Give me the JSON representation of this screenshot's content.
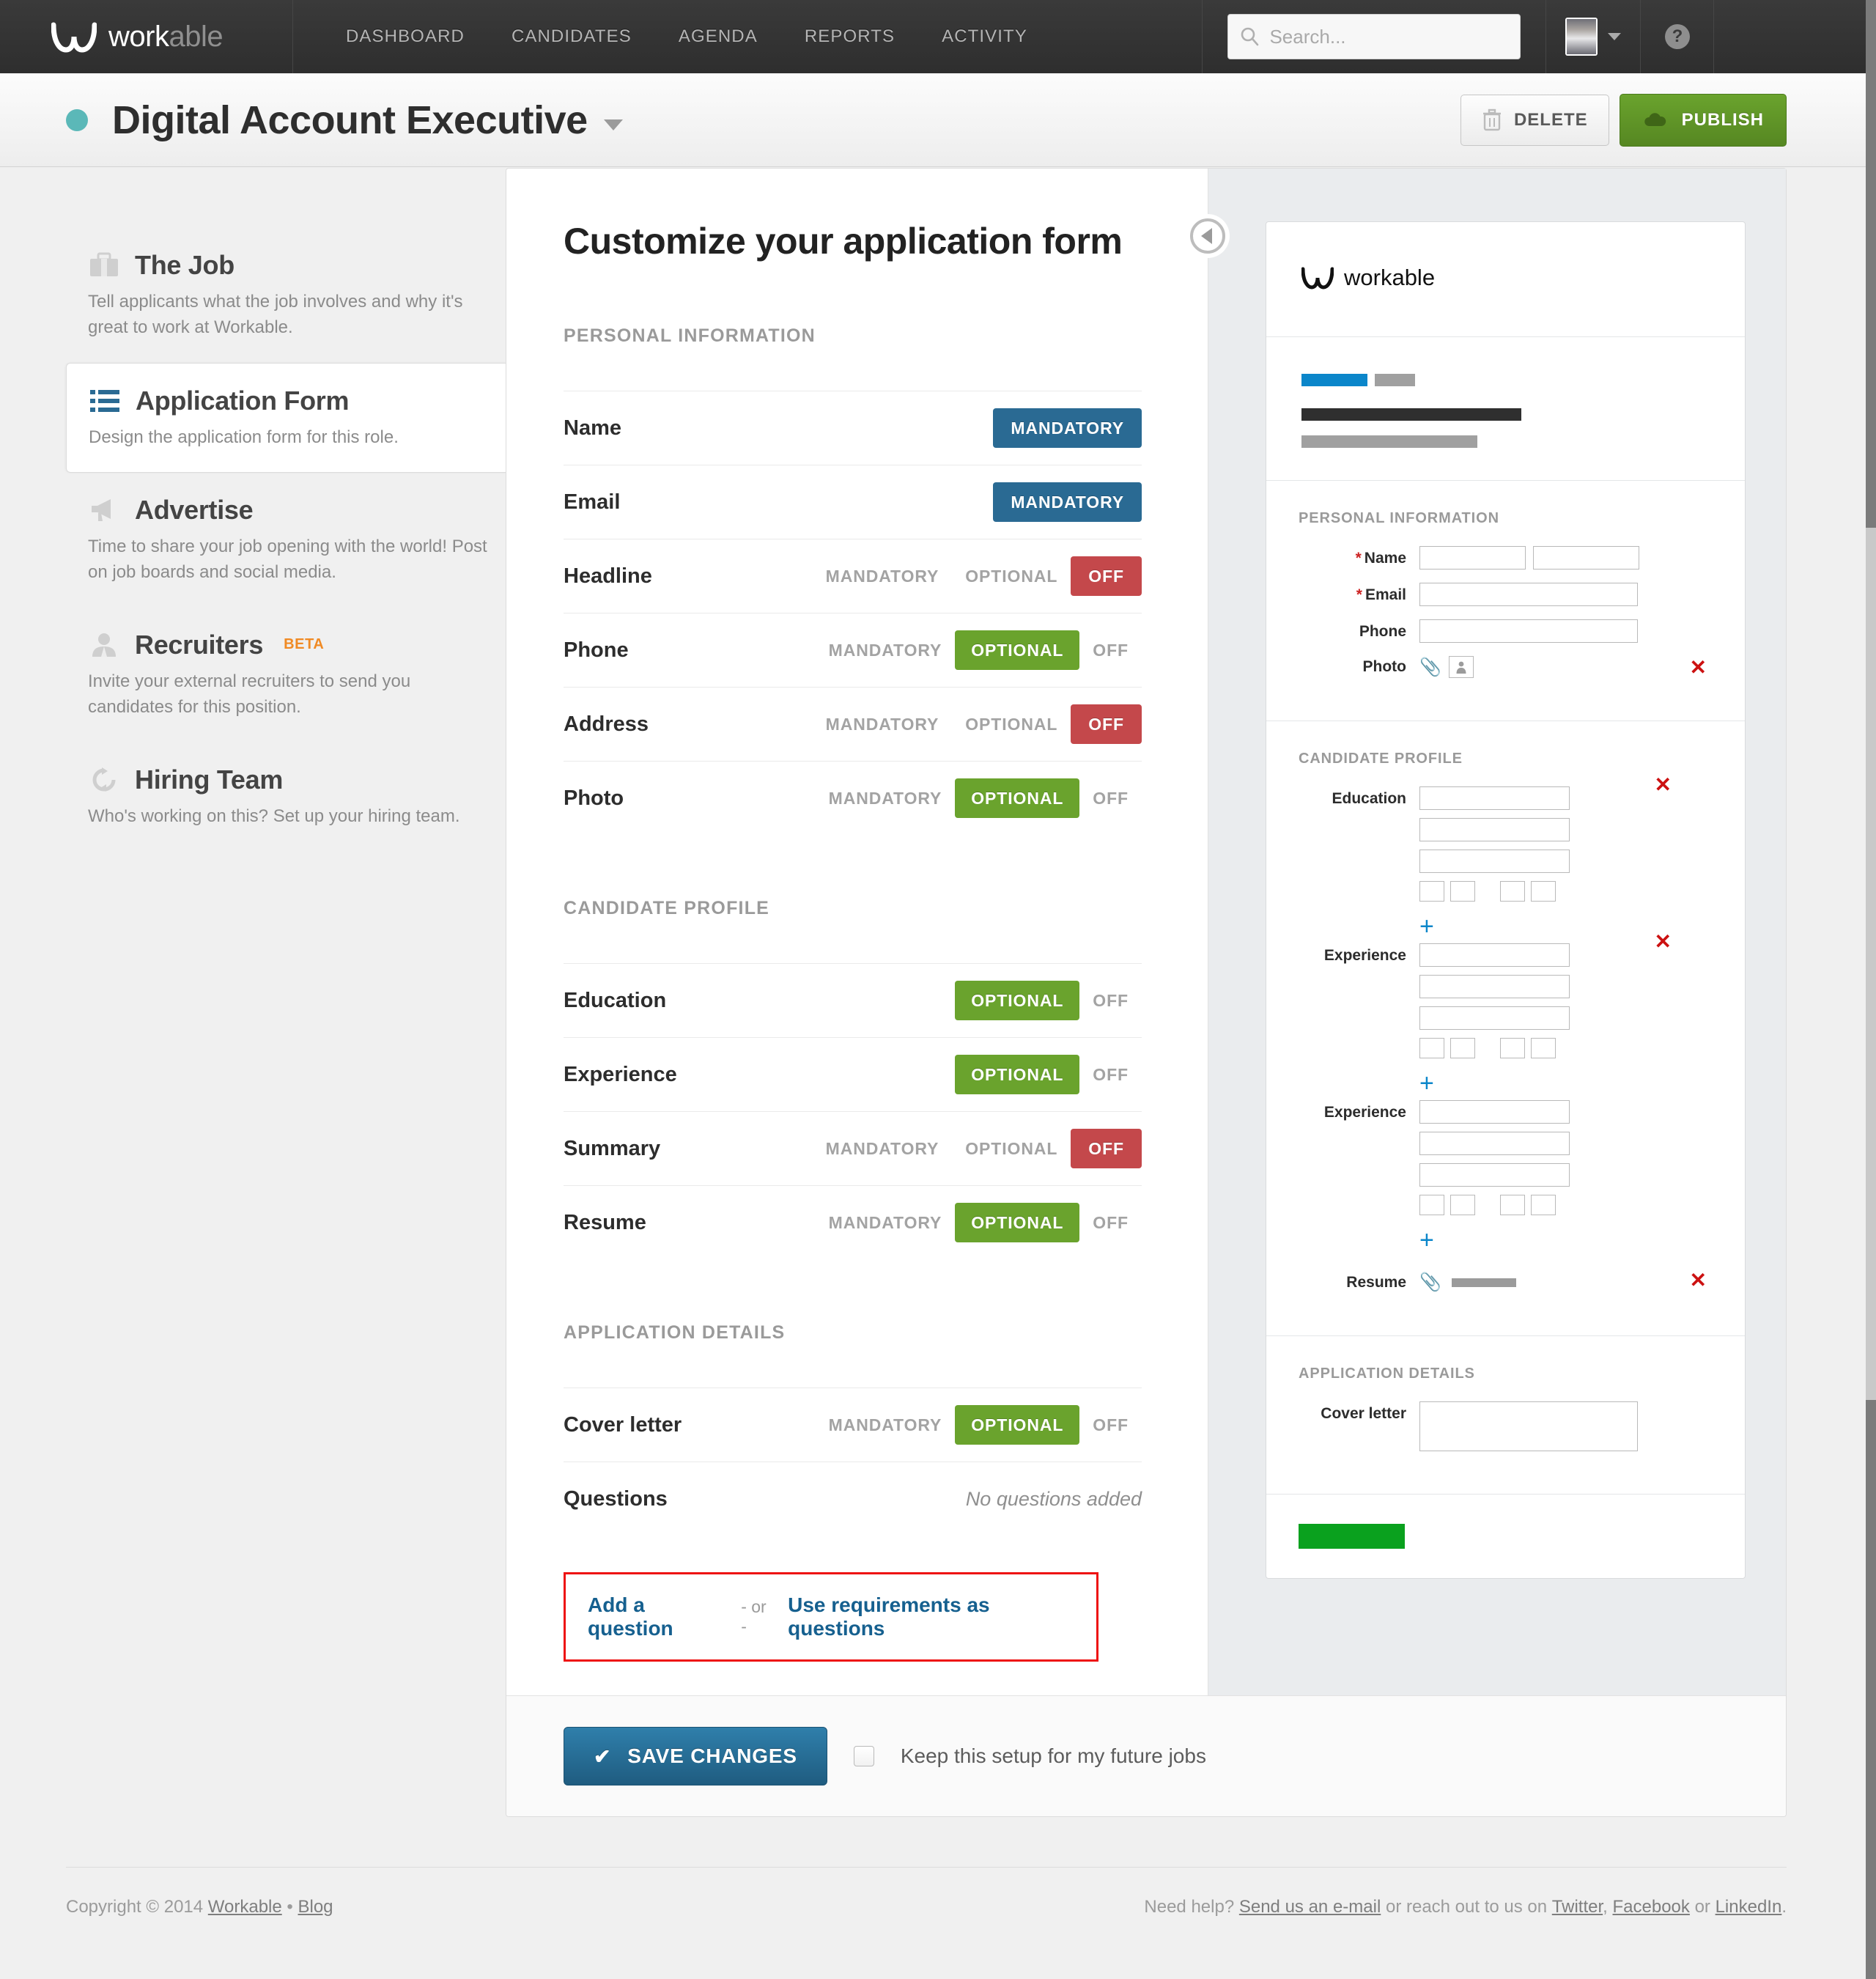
{
  "nav": {
    "brand": {
      "prefix": "work",
      "suffix": "able"
    },
    "links": [
      "DASHBOARD",
      "CANDIDATES",
      "AGENDA",
      "REPORTS",
      "ACTIVITY"
    ],
    "search_placeholder": "Search...",
    "help_glyph": "?"
  },
  "jobbar": {
    "title": "Digital Account Executive",
    "delete_label": "DELETE",
    "publish_label": "PUBLISH"
  },
  "sidebar": {
    "items": [
      {
        "title": "The Job",
        "desc": "Tell applicants what the job involves and why it's great to work at Workable.",
        "icon": "briefcase-icon",
        "active": false
      },
      {
        "title": "Application Form",
        "desc": "Design the application form for this role.",
        "icon": "list-icon",
        "active": true
      },
      {
        "title": "Advertise",
        "desc": "Time to share your job opening with the world! Post on job boards and social media.",
        "icon": "megaphone-icon",
        "active": false
      },
      {
        "title": "Recruiters",
        "badge": "BETA",
        "desc": "Invite your external recruiters to send you candidates for this position.",
        "icon": "person-icon",
        "active": false
      },
      {
        "title": "Hiring Team",
        "desc": "Who's working on this? Set up your hiring team.",
        "icon": "refresh-icon",
        "active": false
      }
    ]
  },
  "form": {
    "title": "Customize your application form",
    "options": {
      "mandatory": "MANDATORY",
      "optional": "OPTIONAL",
      "off": "OFF"
    },
    "sections": [
      {
        "label": "PERSONAL INFORMATION",
        "rows": [
          {
            "label": "Name",
            "choices": [
              "mandatory"
            ],
            "selected": "mandatory"
          },
          {
            "label": "Email",
            "choices": [
              "mandatory"
            ],
            "selected": "mandatory"
          },
          {
            "label": "Headline",
            "choices": [
              "mandatory",
              "optional",
              "off"
            ],
            "selected": "off"
          },
          {
            "label": "Phone",
            "choices": [
              "mandatory",
              "optional",
              "off"
            ],
            "selected": "optional"
          },
          {
            "label": "Address",
            "choices": [
              "mandatory",
              "optional",
              "off"
            ],
            "selected": "off"
          },
          {
            "label": "Photo",
            "choices": [
              "mandatory",
              "optional",
              "off"
            ],
            "selected": "optional"
          }
        ]
      },
      {
        "label": "CANDIDATE PROFILE",
        "rows": [
          {
            "label": "Education",
            "choices": [
              "optional",
              "off"
            ],
            "selected": "optional"
          },
          {
            "label": "Experience",
            "choices": [
              "optional",
              "off"
            ],
            "selected": "optional"
          },
          {
            "label": "Summary",
            "choices": [
              "mandatory",
              "optional",
              "off"
            ],
            "selected": "off"
          },
          {
            "label": "Resume",
            "choices": [
              "mandatory",
              "optional",
              "off"
            ],
            "selected": "optional"
          }
        ]
      },
      {
        "label": "APPLICATION DETAILS",
        "rows": [
          {
            "label": "Cover letter",
            "choices": [
              "mandatory",
              "optional",
              "off"
            ],
            "selected": "optional"
          },
          {
            "label": "Questions",
            "choices": [],
            "note": "No questions added"
          }
        ]
      }
    ],
    "add_question_label": "Add a question",
    "or_label": "- or -",
    "use_requirements_label": "Use requirements as questions"
  },
  "preview": {
    "brand": {
      "prefix": "work",
      "suffix": "able"
    },
    "sections": [
      {
        "label": "PERSONAL INFORMATION",
        "fields": [
          "Name",
          "Email",
          "Phone",
          "Photo"
        ]
      },
      {
        "label": "CANDIDATE PROFILE",
        "fields": [
          "Education",
          "Experience",
          "Experience",
          "Resume"
        ]
      },
      {
        "label": "APPLICATION DETAILS",
        "fields": [
          "Cover letter"
        ]
      }
    ],
    "labels": {
      "name": "Name",
      "email": "Email",
      "phone": "Phone",
      "photo": "Photo",
      "education": "Education",
      "experience": "Experience",
      "resume": "Resume",
      "cover_letter": "Cover letter"
    },
    "required_marker": "*",
    "remove_glyph": "✕",
    "add_glyph": "+"
  },
  "savebar": {
    "save_label": "SAVE CHANGES",
    "check_glyph": "✔",
    "keep_setup_label": "Keep this setup for my future jobs"
  },
  "footer": {
    "copyright": "Copyright © 2014",
    "workable_link": "Workable",
    "dot": "•",
    "blog_link": "Blog",
    "need_help": "Need help?",
    "email_link": "Send us an e-mail",
    "reach_out": "or reach out to us on",
    "twitter": "Twitter",
    "comma": ",",
    "facebook": "Facebook",
    "or": "or",
    "linkedin": "LinkedIn",
    "period": "."
  },
  "colors": {
    "mandatory": "#2a6a93",
    "optional": "#6aa32d",
    "off": "#c4484b",
    "publish": "#5a8c24",
    "highlight_border": "#ee1111",
    "link": "#16608f",
    "status_dot": "#5bb8b8",
    "beta": "#f08a24"
  }
}
